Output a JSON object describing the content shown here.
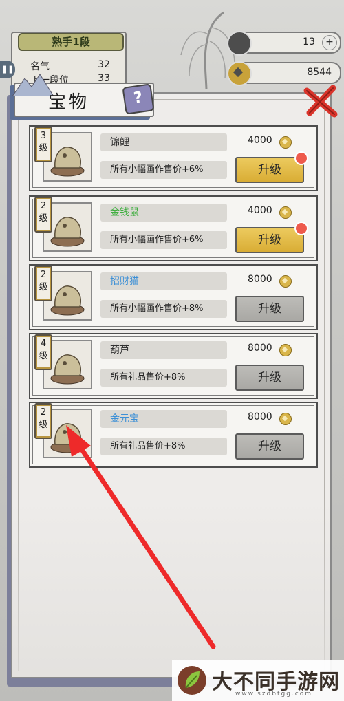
{
  "hud": {
    "rank": "熟手1段",
    "fame_label": "名气",
    "fame_value": "32",
    "next_rank_label": "下一段位",
    "next_rank_value": "33",
    "resource1_value": "13",
    "coins_value": "8544",
    "plus": "+"
  },
  "panel": {
    "title": "宝物",
    "help": "?",
    "close_icon": "close-icon"
  },
  "items": [
    {
      "level_num": "3",
      "level_unit": "级",
      "name": "锦鲤",
      "name_color": "#333333",
      "desc": "所有小幅画作售价+6%",
      "price": "4000",
      "button": "升级",
      "button_state": "gold",
      "badge": true
    },
    {
      "level_num": "2",
      "level_unit": "级",
      "name": "金钱鼠",
      "name_color": "#3fae3f",
      "desc": "所有小幅画作售价+6%",
      "price": "4000",
      "button": "升级",
      "button_state": "gold",
      "badge": true
    },
    {
      "level_num": "2",
      "level_unit": "级",
      "name": "招财猫",
      "name_color": "#3b8fd6",
      "desc": "所有小幅画作售价+8%",
      "price": "8000",
      "button": "升级",
      "button_state": "gray",
      "badge": false
    },
    {
      "level_num": "4",
      "level_unit": "级",
      "name": "葫芦",
      "name_color": "#333333",
      "desc": "所有礼品售价+8%",
      "price": "8000",
      "button": "升级",
      "button_state": "gray",
      "badge": false
    },
    {
      "level_num": "2",
      "level_unit": "级",
      "name": "金元宝",
      "name_color": "#3b8fd6",
      "desc": "所有礼品售价+8%",
      "price": "8000",
      "button": "升级",
      "button_state": "gray",
      "badge": false
    }
  ],
  "watermark": {
    "text": "大不同手游网",
    "url": "www.szdbtgg.com"
  },
  "colors": {
    "gold_button": "#d9ad35",
    "gray_button": "#a9a8a4",
    "arrow": "#ee2a2a"
  }
}
